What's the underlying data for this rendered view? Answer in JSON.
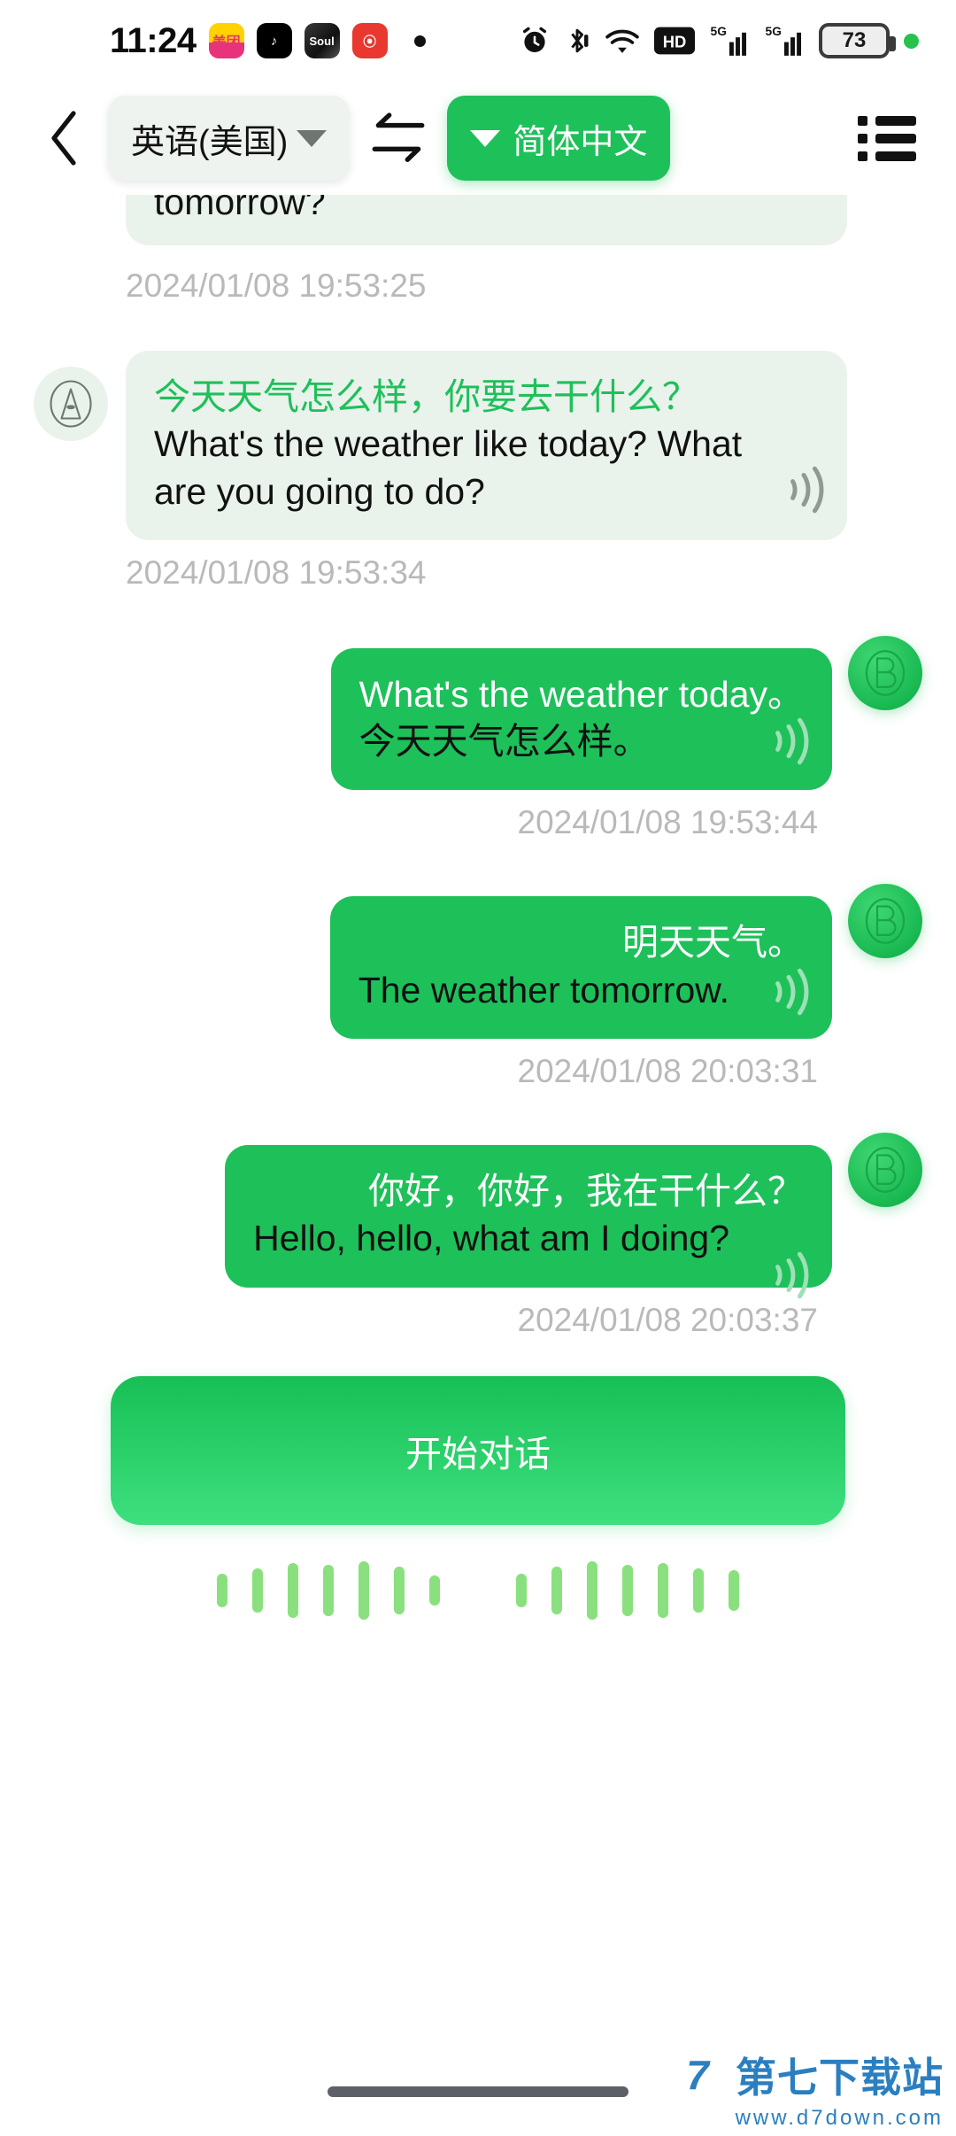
{
  "status_bar": {
    "time": "11:24",
    "app_icons": [
      {
        "name": "meituan-app-icon",
        "glyph": "美团"
      },
      {
        "name": "tiktok-app-icon",
        "glyph": "♪"
      },
      {
        "name": "soul-app-icon",
        "glyph": "Soul"
      },
      {
        "name": "netease-music-app-icon",
        "glyph": "⦿"
      }
    ],
    "icons": [
      "alarm-icon",
      "bluetooth-icon",
      "wifi-icon",
      "hd-voice-icon",
      "signal-5g-1-icon",
      "signal-5g-2-icon"
    ],
    "battery_level": "73",
    "recording_dot": "green-status-dot"
  },
  "header": {
    "back_label": "‹",
    "source_language": "英语(美国)",
    "swap_label": "swap-languages",
    "target_language": "简体中文",
    "menu_label": "history-menu"
  },
  "chat": {
    "clipped_message": {
      "text": "tomorrow?",
      "timestamp": "2024/01/08 19:53:25"
    },
    "messages": [
      {
        "side": "in",
        "avatar": "A",
        "primary": "今天天气怎么样，你要去干什么？",
        "secondary": "What's the weather like today? What are you going to do?",
        "timestamp": "2024/01/08 19:53:34"
      },
      {
        "side": "out",
        "avatar": "B",
        "primary": "What's the weather today。",
        "secondary": "今天天气怎么样。",
        "timestamp": "2024/01/08 19:53:44"
      },
      {
        "side": "out",
        "avatar": "B",
        "primary": "明天天气。",
        "secondary": "The weather tomorrow.",
        "timestamp": "2024/01/08 20:03:31"
      },
      {
        "side": "out",
        "avatar": "B",
        "primary": "你好，你好，我在干什么？",
        "secondary": "Hello, hello, what am I doing?",
        "timestamp": "2024/01/08 20:03:37"
      }
    ]
  },
  "bottom": {
    "start_button": "开始对话",
    "waveform_group_1": [
      38,
      50,
      62,
      58,
      66,
      54,
      34
    ],
    "waveform_group_2": [
      38,
      54,
      66,
      58,
      62,
      50,
      46
    ]
  },
  "watermark": {
    "logo": "7",
    "site_name": "第七下载站",
    "url": "www.d7down.com"
  },
  "colors": {
    "brand_green": "#1ec05a",
    "bubble_in": "#eaf2ec",
    "timestamp_gray": "#b9b9b9",
    "wave_green": "#8ae07e",
    "watermark_blue": "#2b7fc0"
  }
}
